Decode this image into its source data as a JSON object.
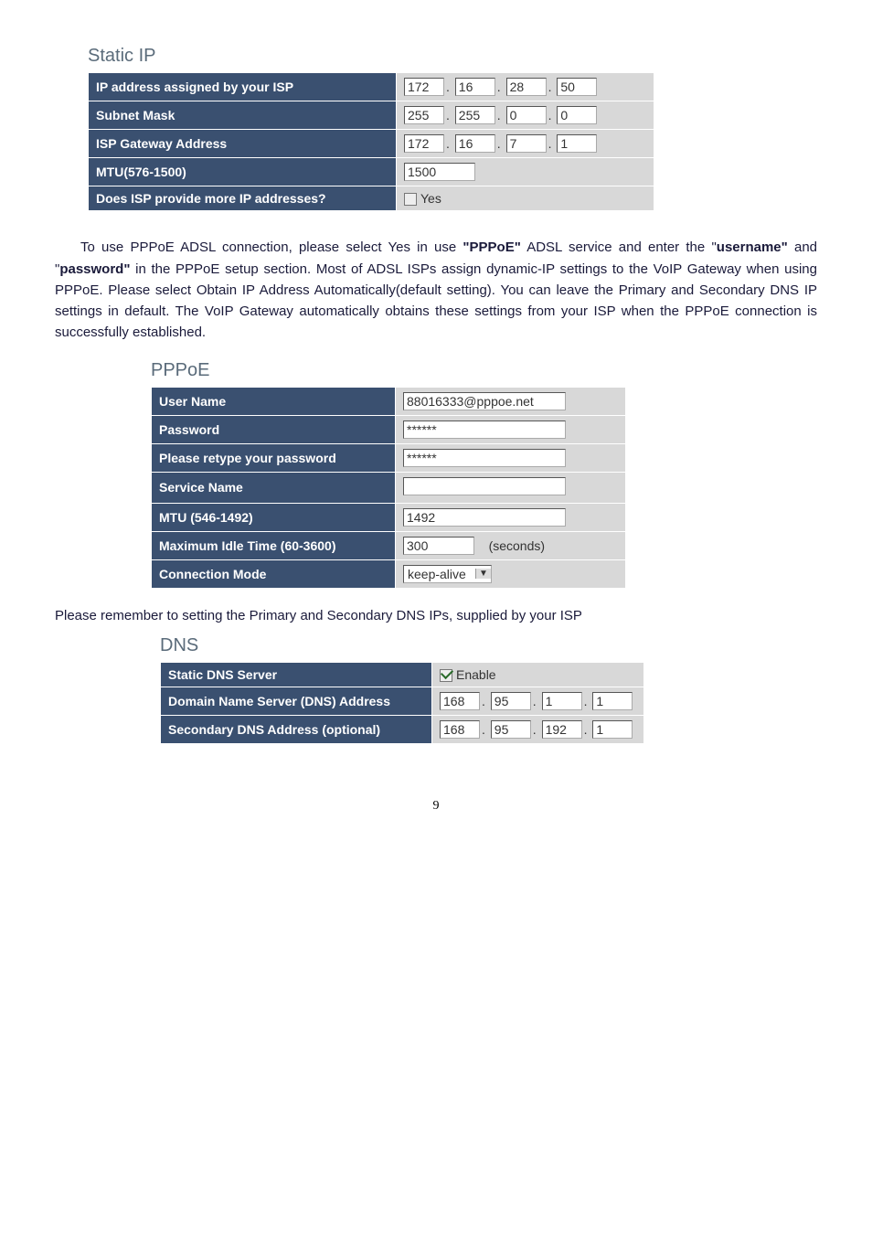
{
  "static_ip": {
    "title": "Static IP",
    "rows": {
      "ip_label": "IP address assigned by your ISP",
      "ip": [
        "172",
        "16",
        "28",
        "50"
      ],
      "mask_label": "Subnet Mask",
      "mask": [
        "255",
        "255",
        "0",
        "0"
      ],
      "gw_label": "ISP Gateway Address",
      "gw": [
        "172",
        "16",
        "7",
        "1"
      ],
      "mtu_label": "MTU(576-1500)",
      "mtu": "1500",
      "more_label": "Does ISP provide more IP addresses?",
      "more_text": "Yes"
    }
  },
  "para1_a": "To use PPPoE ADSL connection, please select Yes in use ",
  "para1_b": "\"PPPoE\"",
  "para1_c": " ADSL service and enter the \"",
  "para1_d": "username\"",
  "para1_e": " and \"",
  "para1_f": "password\"",
  "para1_g": " in the PPPoE setup section. Most of ADSL ISPs assign dynamic-IP settings to the VoIP Gateway when using PPPoE. Please select Obtain IP Address Automatically(default setting). You can leave the Primary and Secondary DNS IP settings in default. The VoIP Gateway automatically obtains these settings from your ISP when the PPPoE connection is successfully established.",
  "pppoe": {
    "title": "PPPoE",
    "user_label": "User Name",
    "user": "88016333@pppoe.net",
    "pass_label": "Password",
    "pass": "******",
    "repass_label": "Please retype your password",
    "repass": "******",
    "svc_label": "Service Name",
    "svc": "",
    "mtu_label": "MTU (546-1492)",
    "mtu": "1492",
    "idle_label": "Maximum Idle Time (60-3600)",
    "idle": "300",
    "idle_unit": "(seconds)",
    "mode_label": "Connection Mode",
    "mode": "keep-alive"
  },
  "para2": "Please remember to setting the Primary and Secondary DNS IPs, supplied by your ISP",
  "dns": {
    "title": "DNS",
    "static_label": "Static DNS Server",
    "enable_text": "Enable",
    "primary_label": "Domain Name Server (DNS) Address",
    "primary": [
      "168",
      "95",
      "1",
      "1"
    ],
    "secondary_label": "Secondary DNS Address (optional)",
    "secondary": [
      "168",
      "95",
      "192",
      "1"
    ]
  },
  "page": "9",
  "dot": "."
}
